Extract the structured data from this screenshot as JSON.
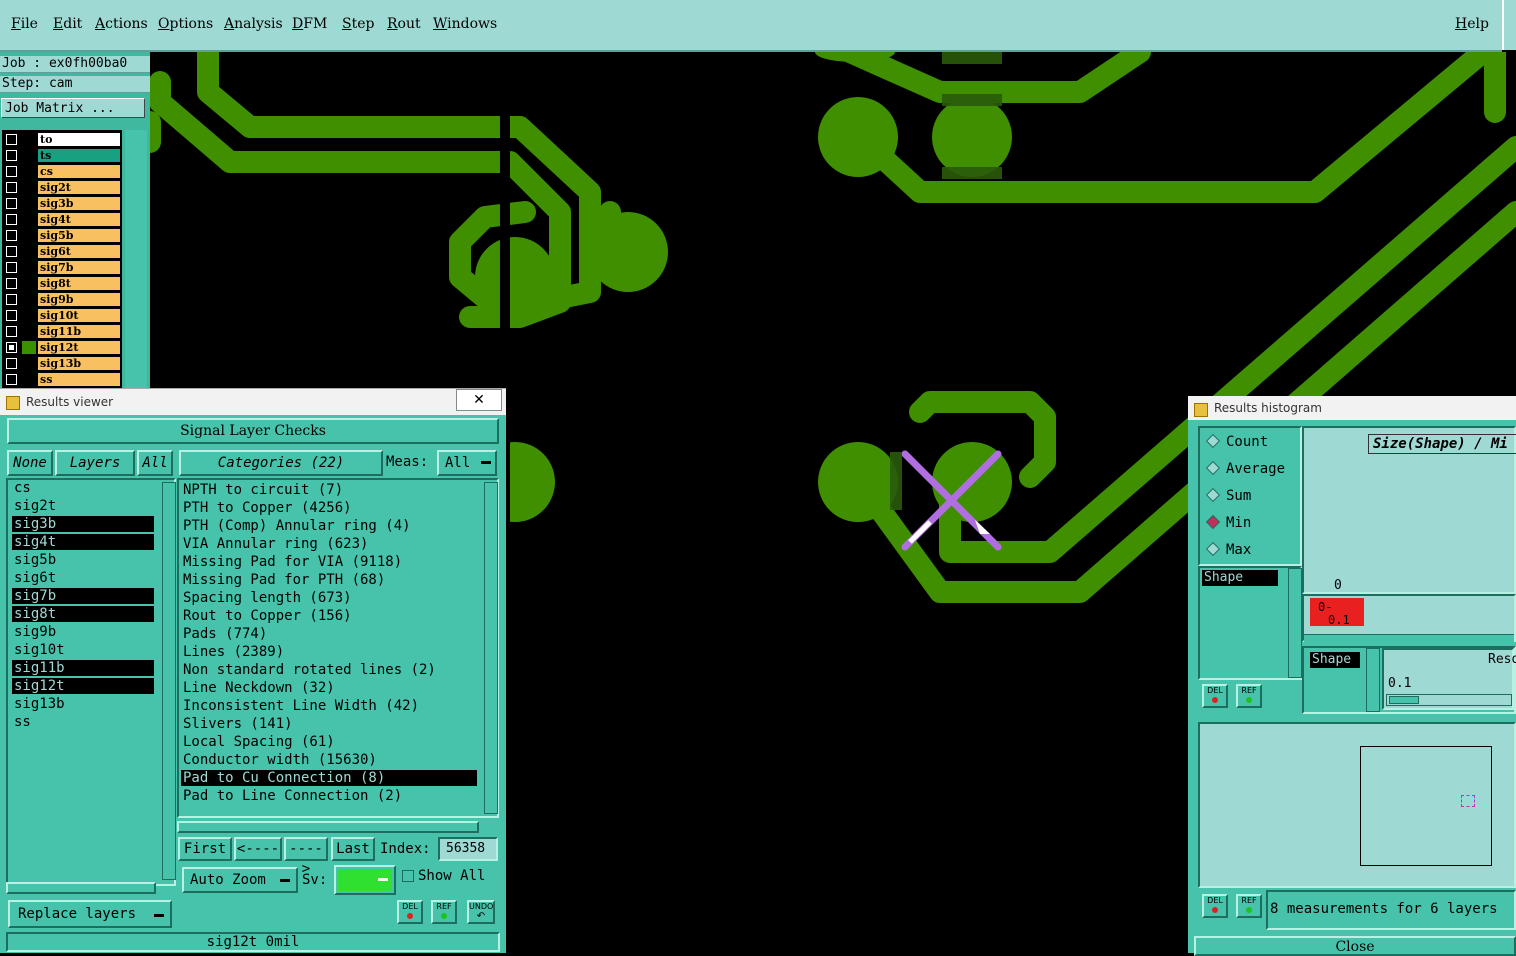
{
  "menubar": {
    "items": [
      "File",
      "Edit",
      "Actions",
      "Options",
      "Analysis",
      "DFM",
      "Step",
      "Rout",
      "Windows"
    ],
    "help": "Help"
  },
  "left_panel": {
    "job": "Job : ex0fh00ba0",
    "step": "Step: cam",
    "job_matrix": "Job Matrix ...",
    "layers": [
      {
        "name": "to",
        "bg": "#ffffff",
        "checked": false,
        "swatch": "#000000"
      },
      {
        "name": "ts",
        "bg": "#18a080",
        "checked": false,
        "swatch": "#000000"
      },
      {
        "name": "cs",
        "bg": "#f8c060",
        "checked": false,
        "swatch": "#000000"
      },
      {
        "name": "sig2t",
        "bg": "#f8c060",
        "checked": false,
        "swatch": "#000000"
      },
      {
        "name": "sig3b",
        "bg": "#f8c060",
        "checked": false,
        "swatch": "#000000"
      },
      {
        "name": "sig4t",
        "bg": "#f8c060",
        "checked": false,
        "swatch": "#000000"
      },
      {
        "name": "sig5b",
        "bg": "#f8c060",
        "checked": false,
        "swatch": "#000000"
      },
      {
        "name": "sig6t",
        "bg": "#f8c060",
        "checked": false,
        "swatch": "#000000"
      },
      {
        "name": "sig7b",
        "bg": "#f8c060",
        "checked": false,
        "swatch": "#000000"
      },
      {
        "name": "sig8t",
        "bg": "#f8c060",
        "checked": false,
        "swatch": "#000000"
      },
      {
        "name": "sig9b",
        "bg": "#f8c060",
        "checked": false,
        "swatch": "#000000"
      },
      {
        "name": "sig10t",
        "bg": "#f8c060",
        "checked": false,
        "swatch": "#000000"
      },
      {
        "name": "sig11b",
        "bg": "#f8c060",
        "checked": false,
        "swatch": "#000000"
      },
      {
        "name": "sig12t",
        "bg": "#f8c060",
        "checked": true,
        "swatch": "#3a9000"
      },
      {
        "name": "sig13b",
        "bg": "#f8c060",
        "checked": false,
        "swatch": "#000000"
      },
      {
        "name": "ss",
        "bg": "#f8c060",
        "checked": false,
        "swatch": "#000000"
      }
    ]
  },
  "results_viewer": {
    "title": "Results viewer",
    "close_glyph": "✕",
    "header": "Signal Layer Checks",
    "none_btn": "None",
    "layers_btn": "Layers",
    "all_btn": "All",
    "categories_btn": "Categories (22)",
    "meas_label": "Meas:",
    "meas_value": "All",
    "layers": [
      {
        "name": "cs",
        "selected": false
      },
      {
        "name": "sig2t",
        "selected": false
      },
      {
        "name": "sig3b",
        "selected": true
      },
      {
        "name": "sig4t",
        "selected": true
      },
      {
        "name": "sig5b",
        "selected": false
      },
      {
        "name": "sig6t",
        "selected": false
      },
      {
        "name": "sig7b",
        "selected": true
      },
      {
        "name": "sig8t",
        "selected": true
      },
      {
        "name": "sig9b",
        "selected": false
      },
      {
        "name": "sig10t",
        "selected": false
      },
      {
        "name": "sig11b",
        "selected": true
      },
      {
        "name": "sig12t",
        "selected": true
      },
      {
        "name": "sig13b",
        "selected": false
      },
      {
        "name": "ss",
        "selected": false
      }
    ],
    "categories": [
      {
        "label": "NPTH to circuit (7)",
        "selected": false
      },
      {
        "label": "PTH to Copper (4256)",
        "selected": false
      },
      {
        "label": "PTH (Comp) Annular ring (4)",
        "selected": false
      },
      {
        "label": "VIA Annular ring (623)",
        "selected": false
      },
      {
        "label": "Missing Pad for VIA (9118)",
        "selected": false
      },
      {
        "label": "Missing Pad for PTH (68)",
        "selected": false
      },
      {
        "label": "Spacing length (673)",
        "selected": false
      },
      {
        "label": "Rout to Copper (156)",
        "selected": false
      },
      {
        "label": "Pads (774)",
        "selected": false
      },
      {
        "label": "Lines (2389)",
        "selected": false
      },
      {
        "label": "Non standard rotated lines (2)",
        "selected": false
      },
      {
        "label": "Line Neckdown (32)",
        "selected": false
      },
      {
        "label": "Inconsistent Line Width (42)",
        "selected": false
      },
      {
        "label": "Slivers (141)",
        "selected": false
      },
      {
        "label": "Local Spacing (61)",
        "selected": false
      },
      {
        "label": "Conductor width (15630)",
        "selected": false
      },
      {
        "label": "Pad to Cu Connection (8)",
        "selected": true
      },
      {
        "label": "Pad to Line Connection (2)",
        "selected": false
      }
    ],
    "first_btn": "First",
    "prev_btn": "<----",
    "next_btn": "---->",
    "last_btn": "Last",
    "index_label": "Index:",
    "index_value": "56358",
    "auto_zoom": "Auto Zoom",
    "sv_label": "Sv:",
    "sv_color": "#30e030",
    "show_all": "Show All",
    "replace_layers": "Replace layers",
    "del": "DEL",
    "ref": "REF",
    "undo": "UNDO",
    "status": "sig12t 0mil"
  },
  "results_histogram": {
    "title": "Results histogram",
    "radios": [
      {
        "label": "Count",
        "on": false
      },
      {
        "label": "Average",
        "on": false
      },
      {
        "label": "Sum",
        "on": false
      },
      {
        "label": "Min",
        "on": true
      },
      {
        "label": "Max",
        "on": false
      }
    ],
    "shape_list_item": "Shape",
    "axis_title": "Size(Shape) / Mi",
    "zero_label": "0",
    "bar_label_top": "0-",
    "bar_label_bottom": "0.1",
    "bar_color": "#e82020",
    "shape_box": "Shape",
    "resol_label": "Resol",
    "resol_value": "0.1",
    "del": "DEL",
    "ref": "REF",
    "measurements": "8 measurements for 6 layers",
    "close": "Close"
  },
  "colors": {
    "copper": "#3f8f00",
    "ui_bg": "#46c3aa",
    "menubar": "#9fd9d4",
    "marker": "#b06ee0"
  }
}
